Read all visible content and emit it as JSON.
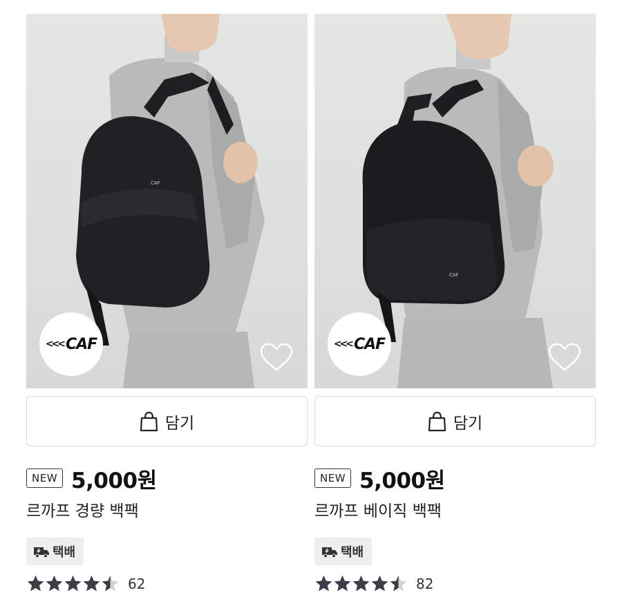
{
  "products": [
    {
      "brand_logo": "CAF",
      "cart_label": "담기",
      "new_badge": "NEW",
      "price": "5,000원",
      "name": "르까프 경량 백팩",
      "delivery_label": "택배",
      "rating": 4.5,
      "review_count": "62",
      "icons": [
        "heart-outline-icon",
        "shopping-bag-icon",
        "delivery-truck-icon",
        "star-icon"
      ]
    },
    {
      "brand_logo": "CAF",
      "cart_label": "담기",
      "new_badge": "NEW",
      "price": "5,000원",
      "name": "르까프 베이직 백팩",
      "delivery_label": "택배",
      "rating": 4.5,
      "review_count": "82",
      "icons": [
        "heart-outline-icon",
        "shopping-bag-icon",
        "delivery-truck-icon",
        "star-icon"
      ]
    }
  ],
  "colors": {
    "star": "#3a3f47",
    "star_empty": "#cfd3d8",
    "tag_bg": "#eeeeee",
    "button_border": "#d9d9d9"
  }
}
